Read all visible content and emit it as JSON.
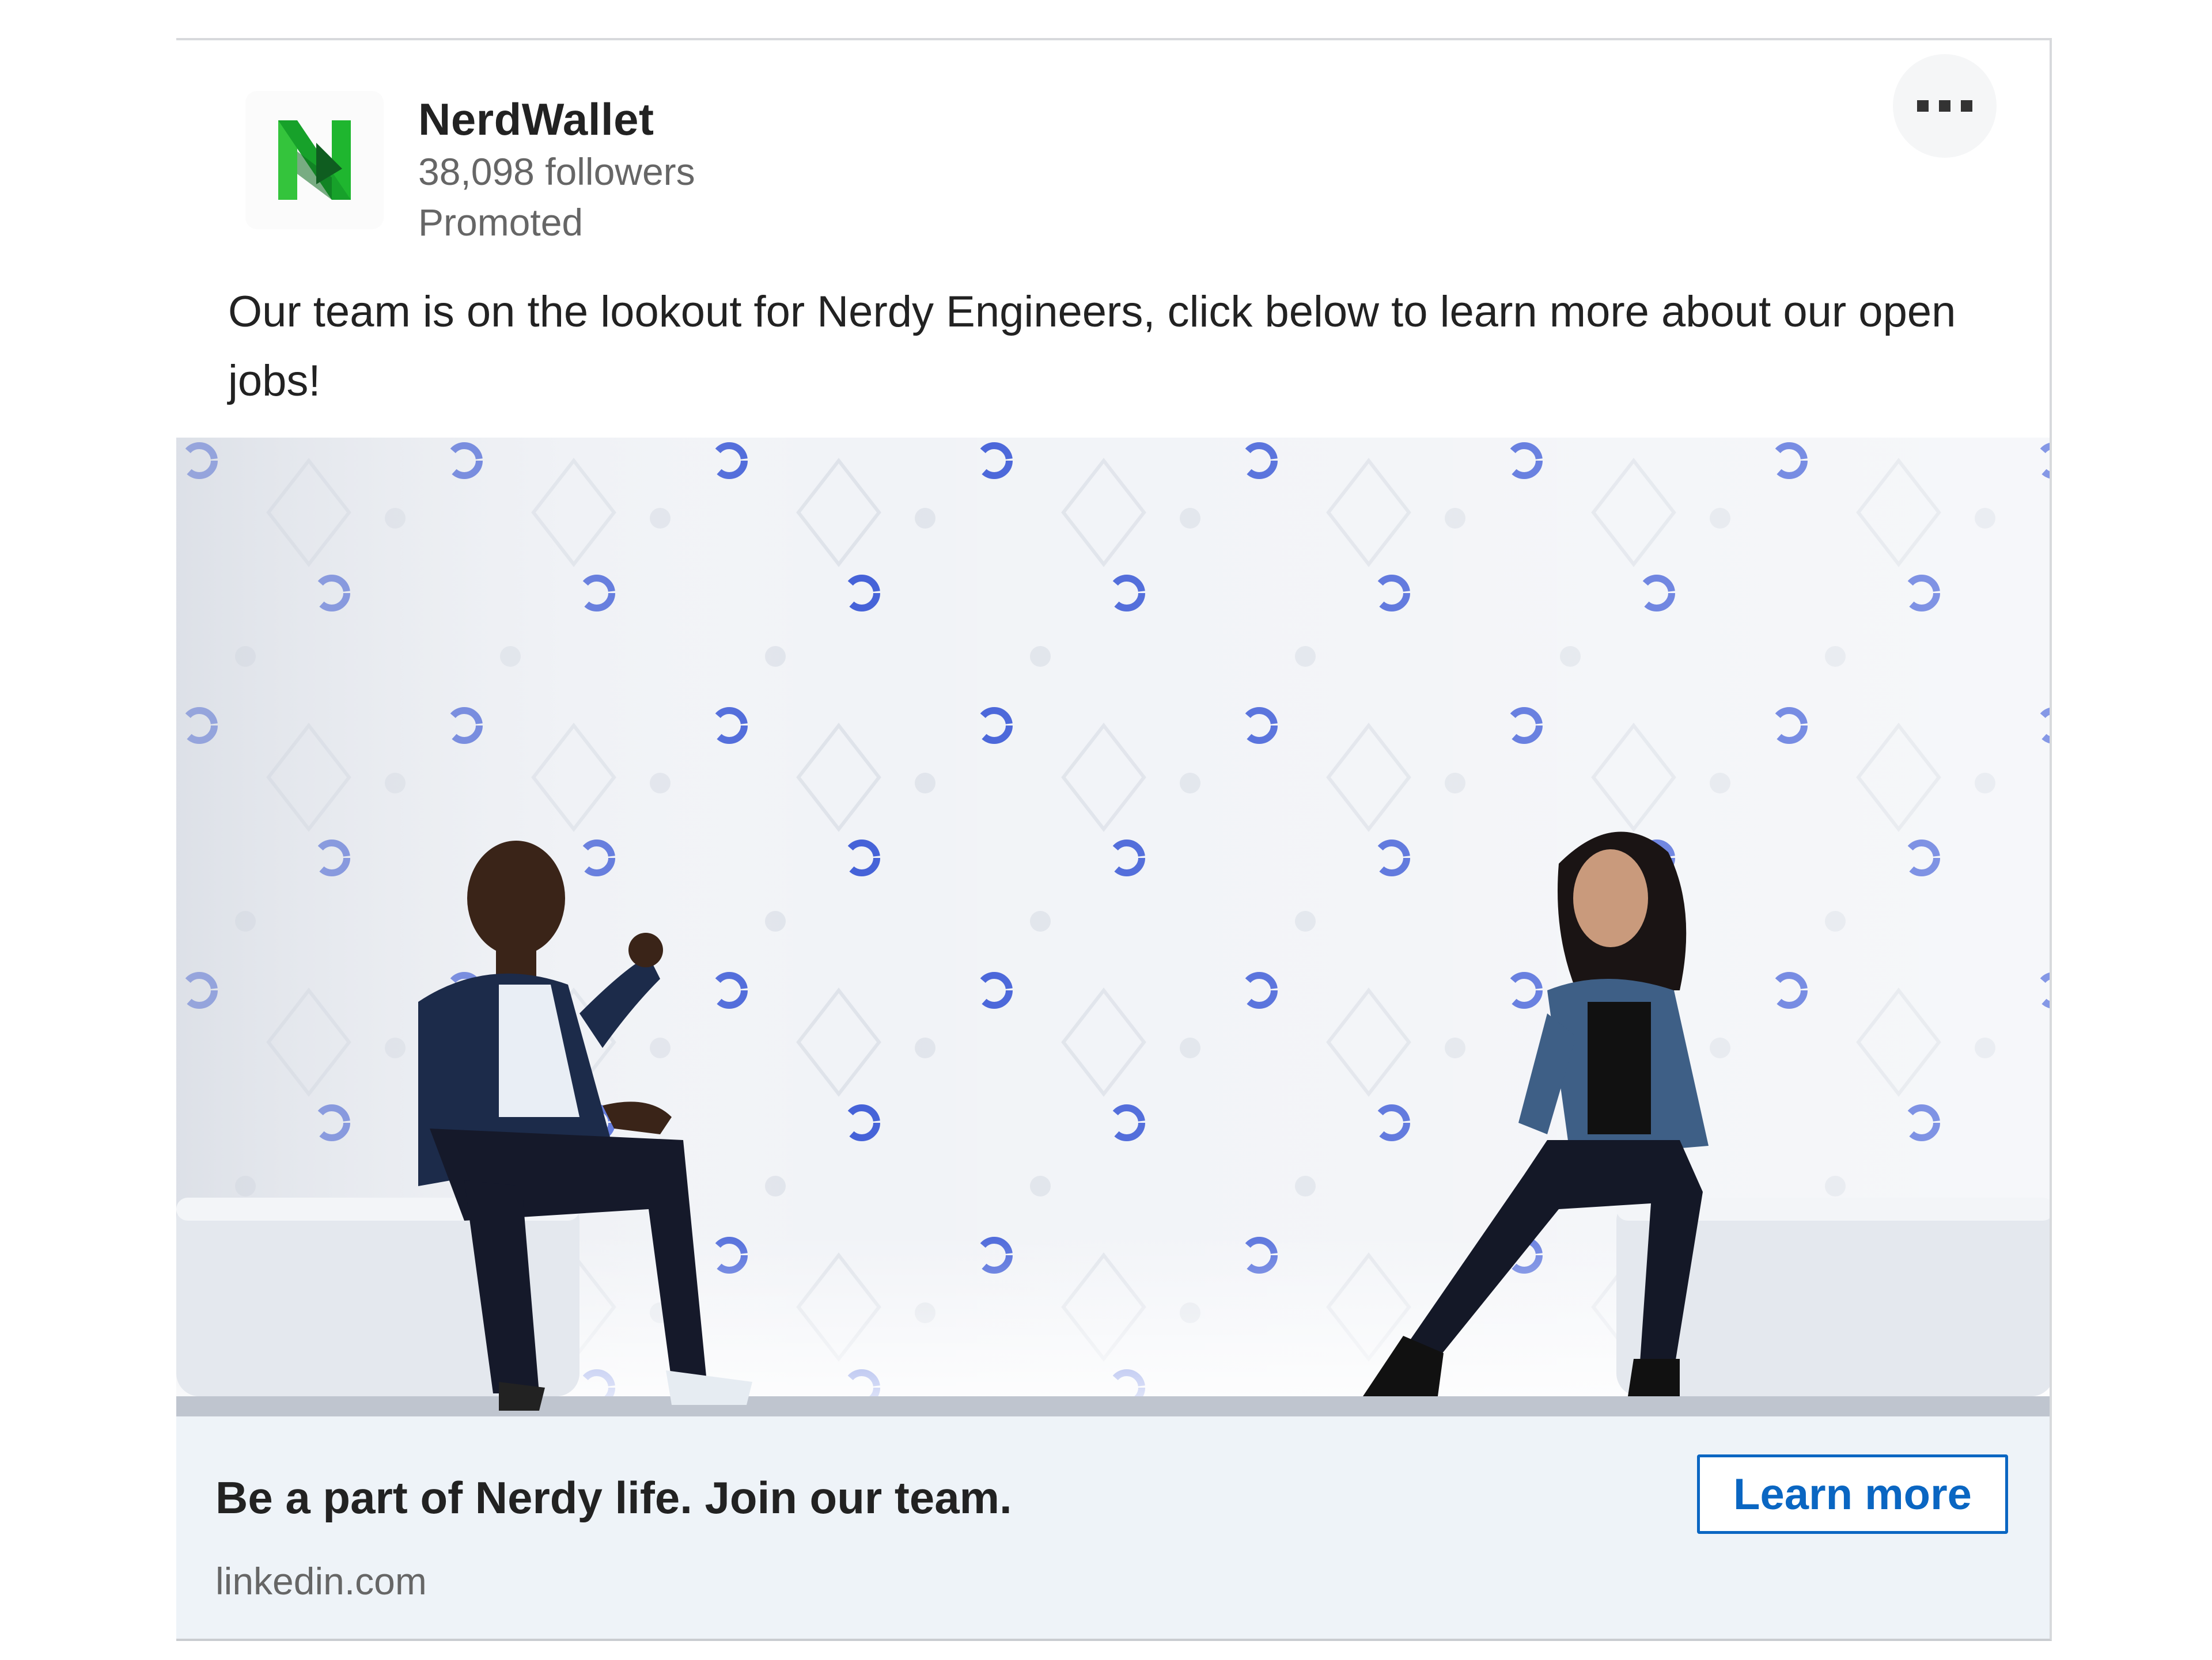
{
  "advertiser": {
    "name": "NerdWallet",
    "followers": "38,098 followers",
    "label": "Promoted",
    "logo_icon": "nerdwallet-n-logo",
    "brand_color": "#1fb62f"
  },
  "post": {
    "text": "Our team is on the lookout for Nerdy Engineers, click below to learn more about our open jobs!",
    "image_icon": "photo-two-people-talking"
  },
  "cta": {
    "headline": "Be a part of Nerdy life. Join our team.",
    "domain": "linkedin.com",
    "button_label": "Learn more",
    "accent_color": "#0a66c2"
  },
  "controls": {
    "more_icon": "more-horizontal-icon"
  }
}
